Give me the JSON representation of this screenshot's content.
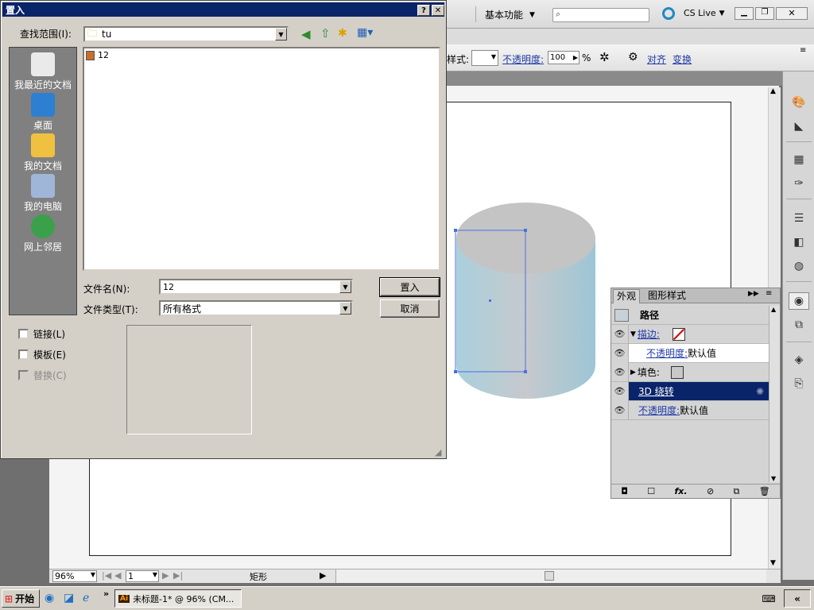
{
  "dialog": {
    "title": "置入",
    "lookin_label": "查找范围(I):",
    "lookin_value": "tu",
    "places": [
      "我最近的文档",
      "桌面",
      "我的文档",
      "我的电脑",
      "网上邻居"
    ],
    "files": [
      {
        "name": "12"
      }
    ],
    "filename_label": "文件名(N):",
    "filename_value": "12",
    "filetype_label": "文件类型(T):",
    "filetype_value": "所有格式",
    "place_button": "置入",
    "cancel_button": "取消",
    "checkboxes": [
      {
        "label": "链接(L)",
        "disabled": false
      },
      {
        "label": "模板(E)",
        "disabled": false
      },
      {
        "label": "替换(C)",
        "disabled": true
      }
    ]
  },
  "app": {
    "workspace": "基本功能",
    "cs_live": "CS Live",
    "control_bar": {
      "style_label": "样式:",
      "opacity_label": "不透明度:",
      "opacity_value": "100",
      "opacity_unit": "%",
      "align": "对齐",
      "transform": "变换"
    },
    "status": {
      "zoom": "96%",
      "page": "1",
      "tool": "矩形"
    }
  },
  "appearance": {
    "tabs": [
      "外观",
      "图形样式"
    ],
    "object": "路径",
    "rows": [
      {
        "label": "描边:",
        "value": ""
      },
      {
        "label": "不透明度:",
        "value": "默认值"
      },
      {
        "label": "填色:",
        "value": ""
      },
      {
        "label": "3D 绕转",
        "value": ""
      },
      {
        "label": "不透明度:",
        "value": "默认值"
      }
    ],
    "footer_fx": "fx."
  },
  "taskbar": {
    "start": "开始",
    "task": "未标题-1* @ 96% (CM..."
  },
  "colors": {
    "titlebar": "#0a246a",
    "selection": "#0a246a",
    "places_bg": "#808080",
    "link": "#1f3aa8"
  }
}
